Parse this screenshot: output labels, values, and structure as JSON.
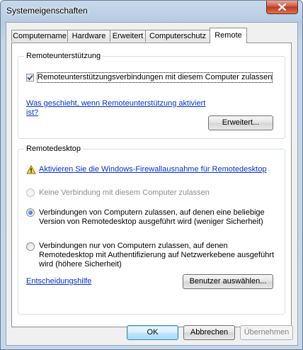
{
  "window": {
    "title": "Systemeigenschaften"
  },
  "tabs": [
    {
      "label": "Computername",
      "active": false
    },
    {
      "label": "Hardware",
      "active": false
    },
    {
      "label": "Erweitert",
      "active": false
    },
    {
      "label": "Computerschutz",
      "active": false
    },
    {
      "label": "Remote",
      "active": true
    }
  ],
  "remote_assistance": {
    "group_title": "Remoteunterstützung",
    "checkbox_label": "Remoteunterstützungsverbindungen mit diesem Computer zulassen",
    "checkbox_checked": true,
    "help_link": "Was geschieht, wenn Remoteunterstützung aktiviert ist?",
    "advanced_button": "Erweitert..."
  },
  "remote_desktop": {
    "group_title": "Remotedesktop",
    "firewall_link": "Aktivieren Sie die Windows-Firewallausnahme für Remotedesktop",
    "options": [
      {
        "label": "Keine Verbindung mit diesem Computer zulassen",
        "selected": false,
        "enabled": false
      },
      {
        "label": "Verbindungen von Computern zulassen, auf denen eine beliebige Version von Remotedesktop ausgeführt wird (weniger Sicherheit)",
        "selected": true,
        "enabled": true
      },
      {
        "label": "Verbindungen nur von Computern zulassen, auf denen Remotedesktop mit Authentifizierung auf Netzwerkebene ausgeführt wird (höhere Sicherheit)",
        "selected": false,
        "enabled": true
      }
    ],
    "help_link": "Entscheidungshilfe",
    "select_users_button": "Benutzer auswählen..."
  },
  "footer": {
    "ok": "OK",
    "cancel": "Abbrechen",
    "apply": "Übernehmen"
  },
  "colors": {
    "link": "#0033cc",
    "title_bar": "#b6cbe3",
    "close_button": "#c0391f"
  },
  "icons": {
    "close": "close-icon",
    "warning": "warning-icon"
  }
}
